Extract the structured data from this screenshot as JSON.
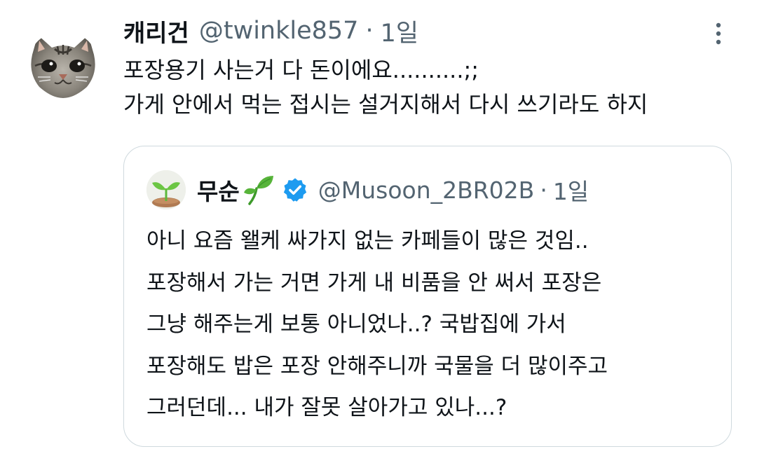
{
  "tweet": {
    "display_name": "캐리건",
    "handle": "@twinkle857",
    "separator": "·",
    "time": "1일",
    "avatar_icon": "cat-face-avatar",
    "more_icon": "more-vertical-icon",
    "text_lines": [
      "포장용기 사는거 다 돈이에요..........;;",
      "가게 안에서 먹는 접시는 설거지해서 다시 쓰기라도 하지"
    ]
  },
  "quoted_tweet": {
    "display_name": "무순",
    "name_emoji": "seedling-icon",
    "verified_icon": "verified-badge-icon",
    "handle": "@Musoon_2BR02B",
    "separator": "·",
    "time": "1일",
    "avatar_icon": "seedling-avatar",
    "text_lines": [
      "아니 요즘 왤케 싸가지 없는 카페들이 많은 것임..",
      "포장해서 가는 거면 가게 내 비품을 안 써서 포장은",
      "그냥 해주는게 보통 아니었나..? 국밥집에 가서",
      "포장해도 밥은 포장 안해주니까 국물을 더 많이주고",
      "그러던데... 내가 잘못 살아가고 있나...?"
    ]
  },
  "colors": {
    "text_primary": "#0f1419",
    "text_secondary": "#536471",
    "border": "#cfd9de",
    "verified_blue": "#1d9bf0",
    "seedling_green": "#4caf30"
  }
}
